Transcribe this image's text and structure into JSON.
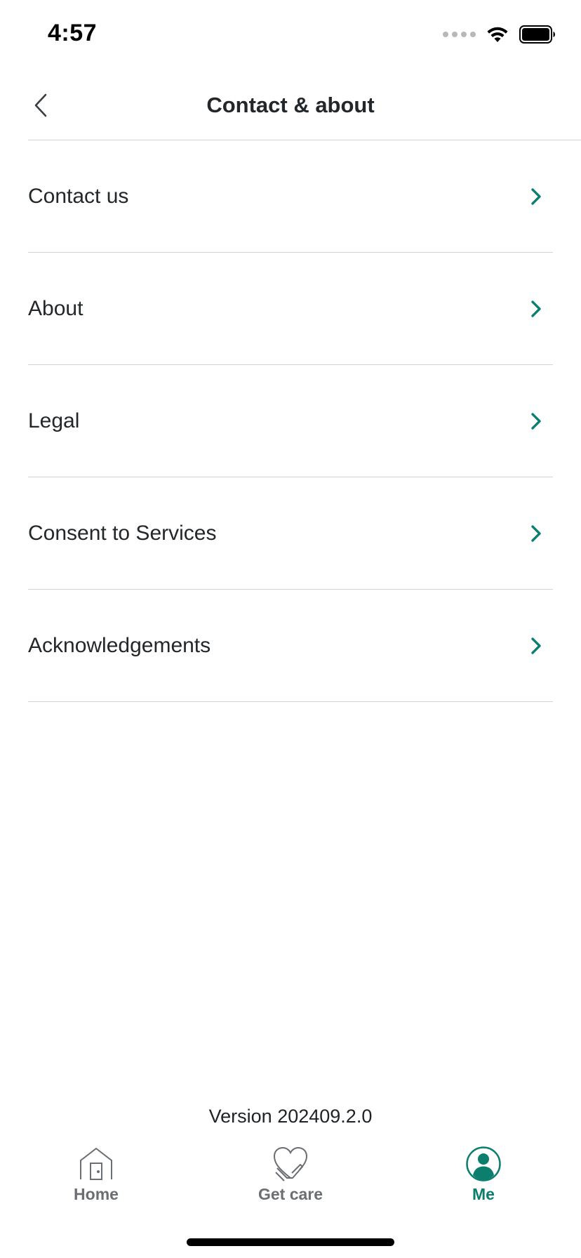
{
  "status_bar": {
    "time": "4:57",
    "icons": [
      "cellular-signal-icon",
      "wifi-icon",
      "battery-icon"
    ]
  },
  "nav": {
    "title": "Contact & about",
    "back_icon": "chevron-left-icon"
  },
  "menu": {
    "items": [
      {
        "label": "Contact us"
      },
      {
        "label": "About"
      },
      {
        "label": "Legal"
      },
      {
        "label": "Consent to Services"
      },
      {
        "label": "Acknowledgements"
      }
    ],
    "chevron_icon": "chevron-right-icon"
  },
  "footer": {
    "version": "Version 202409.2.0"
  },
  "tab_bar": {
    "tabs": [
      {
        "label": "Home",
        "icon": "house-icon",
        "active": false
      },
      {
        "label": "Get care",
        "icon": "heart-hand-icon",
        "active": false
      },
      {
        "label": "Me",
        "icon": "profile-icon",
        "active": true
      }
    ]
  },
  "colors": {
    "accent": "#0b7e6e",
    "text": "#23272a",
    "inactive_tab": "#6b6f73",
    "divider": "#d3d3d3"
  }
}
